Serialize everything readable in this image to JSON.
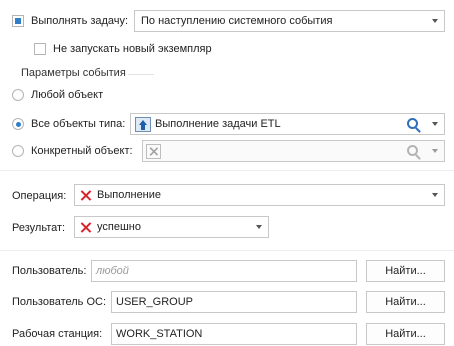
{
  "run_task": {
    "checkbox_label": "Выполнять задачу:",
    "checked": true,
    "mode_value": "По наступлению системного события",
    "no_new_instance_label": "Не запускать новый экземпляр",
    "no_new_instance_checked": false
  },
  "event_params": {
    "section_title": "Параметры события",
    "any_object_label": "Любой объект",
    "all_objects_of_type_label": "Все объекты типа:",
    "all_objects_of_type_value": "Выполнение задачи ETL",
    "specific_object_label": "Конкретный объект:",
    "specific_object_value": "",
    "selected_option": "all_objects_of_type"
  },
  "operation": {
    "label": "Операция:",
    "value": "Выполнение"
  },
  "result": {
    "label": "Результат:",
    "value": "успешно"
  },
  "user": {
    "label": "Пользователь:",
    "placeholder": "любой",
    "value": "",
    "find_label": "Найти..."
  },
  "os_user": {
    "label": "Пользователь ОС:",
    "value": "USER_GROUP",
    "find_label": "Найти..."
  },
  "workstation": {
    "label": "Рабочая станция:",
    "value": "WORK_STATION",
    "find_label": "Найти..."
  },
  "colors": {
    "accent": "#2f7ec9",
    "error_icon": "#d9232e"
  }
}
